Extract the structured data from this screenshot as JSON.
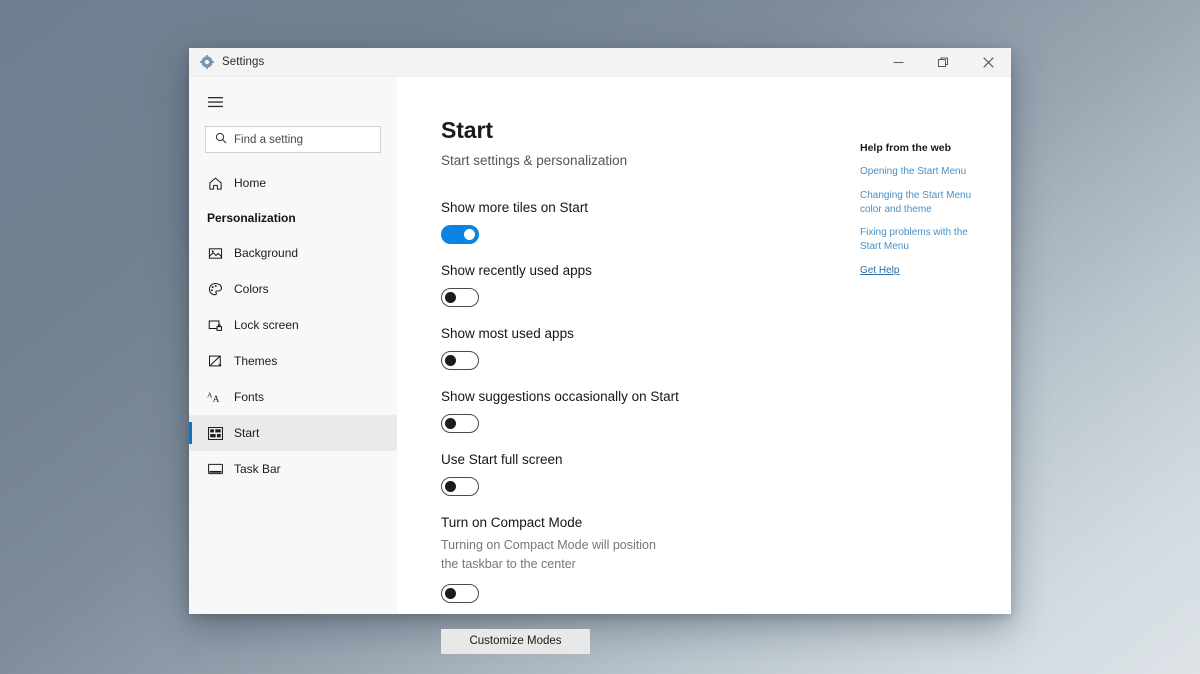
{
  "window": {
    "title": "Settings",
    "app_icon": "gear-icon",
    "controls": {
      "minimize": "minimize-icon",
      "restore": "restore-icon",
      "close": "close-icon"
    }
  },
  "sidebar": {
    "menu_icon": "hamburger-icon",
    "search": {
      "placeholder": "Find a setting",
      "value": "",
      "icon": "search-icon"
    },
    "home": {
      "label": "Home",
      "icon": "home-icon"
    },
    "section_header": "Personalization",
    "items": [
      {
        "label": "Background",
        "icon": "picture-icon",
        "selected": false
      },
      {
        "label": "Colors",
        "icon": "palette-icon",
        "selected": false
      },
      {
        "label": "Lock screen",
        "icon": "lock-screen-icon",
        "selected": false
      },
      {
        "label": "Themes",
        "icon": "brush-icon",
        "selected": false
      },
      {
        "label": "Fonts",
        "icon": "fonts-icon",
        "selected": false
      },
      {
        "label": "Start",
        "icon": "start-tiles-icon",
        "selected": true
      },
      {
        "label": "Task Bar",
        "icon": "taskbar-icon",
        "selected": false
      }
    ]
  },
  "main": {
    "title": "Start",
    "subtitle": "Start settings & personalization",
    "settings": [
      {
        "label": "Show more tiles on Start",
        "state": "on"
      },
      {
        "label": "Show recently used apps",
        "state": "off"
      },
      {
        "label": "Show most used apps",
        "state": "off"
      },
      {
        "label": "Show suggestions occasionally on Start",
        "state": "off"
      },
      {
        "label": "Use Start full screen",
        "state": "off"
      },
      {
        "label": "Turn on Compact Mode",
        "state": "off",
        "description": "Turning on Compact Mode will position the taskbar to the center"
      }
    ],
    "customize_button": "Customize Modes"
  },
  "help": {
    "title": "Help from the web",
    "links": [
      "Opening the Start Menu",
      "Changing the Start Menu color and theme",
      "Fixing problems with the Start Menu"
    ],
    "get_help": "Get Help"
  },
  "colors": {
    "accent": "#0078d4",
    "toggle_on": "#0a84e0",
    "link": "#4a90c4"
  }
}
